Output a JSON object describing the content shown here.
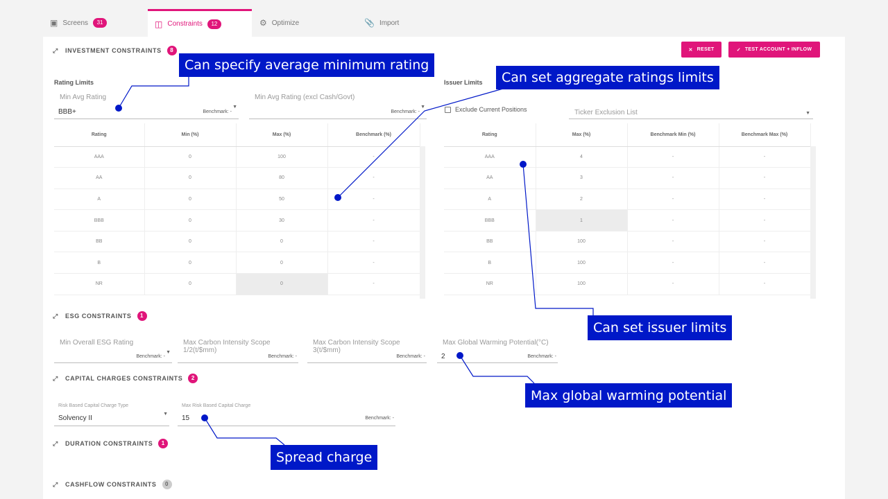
{
  "tabs": [
    {
      "label": "Screens",
      "count": "31",
      "icon": "screens-icon"
    },
    {
      "label": "Constraints",
      "count": "12",
      "icon": "constraints-icon"
    },
    {
      "label": "Optimize",
      "icon": "gear-icon"
    },
    {
      "label": "Import",
      "icon": "paperclip-icon"
    }
  ],
  "investment": {
    "title": "INVESTMENT CONSTRAINTS",
    "count": "8",
    "reset_label": "RESET",
    "test_label": "TEST ACCOUNT + INFLOW",
    "rating_limits_title": "Rating Limits",
    "min_avg": {
      "label": "Min Avg Rating",
      "value": "BBB+",
      "bench": "Benchmark: -"
    },
    "min_avg_excl": {
      "label": "Min Avg Rating (excl Cash/Govt)",
      "bench": "Benchmark: -"
    },
    "rating_table": {
      "headers": [
        "Rating",
        "Min (%)",
        "Max (%)",
        "Benchmark (%)"
      ],
      "rows": [
        [
          "AAA",
          "0",
          "100",
          "-"
        ],
        [
          "AA",
          "0",
          "80",
          "-"
        ],
        [
          "A",
          "0",
          "50",
          "-"
        ],
        [
          "BBB",
          "0",
          "30",
          "-"
        ],
        [
          "BB",
          "0",
          "0",
          "-"
        ],
        [
          "B",
          "0",
          "0",
          "-"
        ],
        [
          "NR",
          "0",
          "0",
          "-"
        ]
      ]
    },
    "issuer_limits_title": "Issuer Limits",
    "exclude_label": "Exclude Current Positions",
    "ticker_label": "Ticker Exclusion List",
    "issuer_table": {
      "headers": [
        "Rating",
        "Max (%)",
        "Benchmark Min (%)",
        "Benchmark Max (%)"
      ],
      "rows": [
        [
          "AAA",
          "4",
          "-",
          "-"
        ],
        [
          "AA",
          "3",
          "-",
          "-"
        ],
        [
          "A",
          "2",
          "-",
          "-"
        ],
        [
          "BBB",
          "1",
          "-",
          "-"
        ],
        [
          "BB",
          "100",
          "-",
          "-"
        ],
        [
          "B",
          "100",
          "-",
          "-"
        ],
        [
          "NR",
          "100",
          "-",
          "-"
        ]
      ]
    }
  },
  "esg": {
    "title": "ESG CONSTRAINTS",
    "count": "1",
    "fields": [
      {
        "label": "Min Overall ESG Rating",
        "value": "",
        "bench": "Benchmark: -"
      },
      {
        "label": "Max Carbon Intensity Scope 1/2(t/$mm)",
        "value": "",
        "bench": "Benchmark: -"
      },
      {
        "label": "Max Carbon Intensity Scope 3(t/$mm)",
        "value": "",
        "bench": "Benchmark: -"
      },
      {
        "label": "Max Global Warming Potential(°C)",
        "value": "2",
        "bench": "Benchmark: -"
      }
    ]
  },
  "capital": {
    "title": "CAPITAL CHARGES CONSTRAINTS",
    "count": "2",
    "type_label": "Risk Based Capital Charge Type",
    "type_value": "Solvency II",
    "max_label": "Max Risk Based Capital Charge",
    "max_value": "15",
    "max_bench": "Benchmark: -"
  },
  "duration": {
    "title": "DURATION CONSTRAINTS",
    "count": "1"
  },
  "cashflow": {
    "title": "CASHFLOW CONSTRAINTS",
    "count": "0"
  },
  "callouts": {
    "min_rating": "Can specify average minimum rating",
    "aggregate": "Can set aggregate ratings limits",
    "issuer": "Can set issuer limits",
    "warming": "Max global warming potential",
    "spread": "Spread charge"
  },
  "colors": {
    "accent": "#e0157a",
    "callout": "#0018c8"
  }
}
